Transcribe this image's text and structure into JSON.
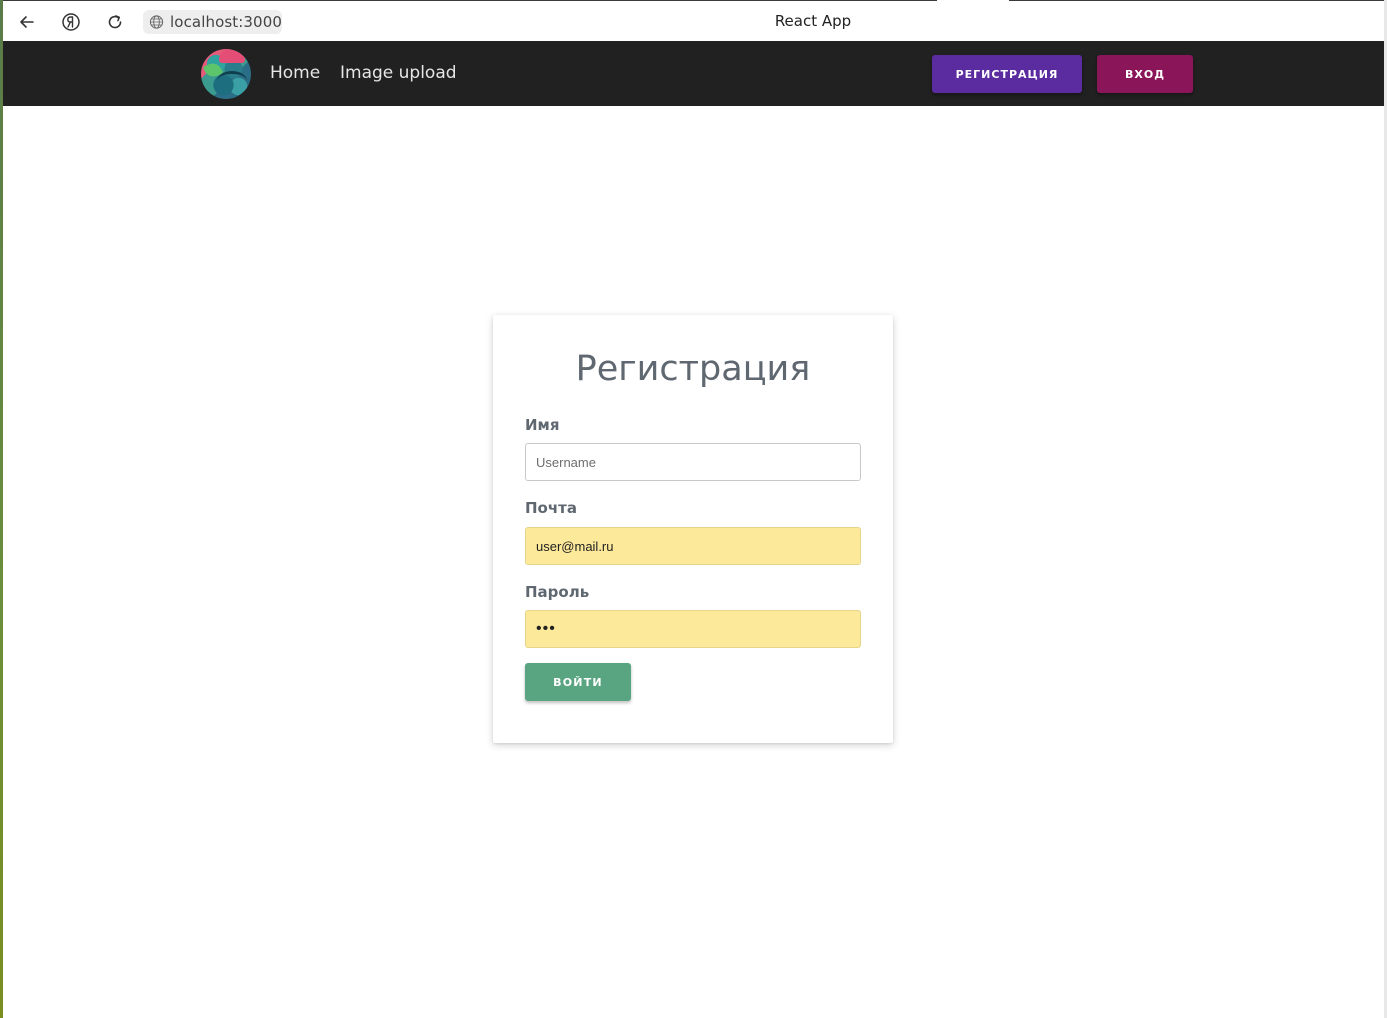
{
  "browser": {
    "url": "localhost:3000",
    "tab_title": "React App",
    "icons": [
      "back-arrow-icon",
      "yandex-icon",
      "reload-icon",
      "globe-icon"
    ]
  },
  "navbar": {
    "links": [
      "Home",
      "Image upload"
    ],
    "register_button": "Регистрация",
    "login_button": "Вход",
    "colors": {
      "background": "#212121",
      "register": "#5b2ba0",
      "login": "#8a1659"
    }
  },
  "form": {
    "title": "Регистрация",
    "fields": {
      "name": {
        "label": "Имя",
        "value": "",
        "placeholder": "Username"
      },
      "email": {
        "label": "Почта",
        "value": "user@mail.ru",
        "placeholder": ""
      },
      "password": {
        "label": "Пароль",
        "value": "•••",
        "placeholder": ""
      }
    },
    "submit_label": "Войти",
    "colors": {
      "submit": "#5aa581",
      "autofill": "#fde99a"
    }
  }
}
